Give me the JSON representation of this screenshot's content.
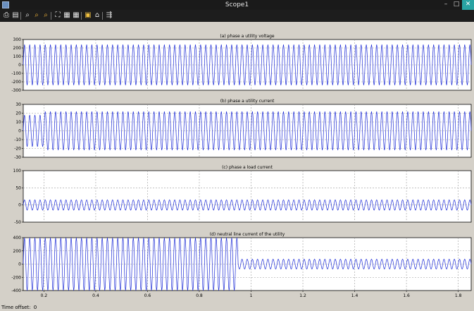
{
  "window": {
    "title": "Scope1",
    "minimize": "–",
    "maximize": "□",
    "close": "✕"
  },
  "toolbar": {
    "items": [
      {
        "name": "print-icon",
        "glyph": "⎙"
      },
      {
        "name": "parameters-icon",
        "glyph": "▤"
      },
      {
        "name": "zoom-in-icon",
        "glyph": "⌕"
      },
      {
        "name": "zoom-x-icon",
        "glyph": "⌕"
      },
      {
        "name": "zoom-y-icon",
        "glyph": "⌕"
      },
      {
        "name": "autoscale-icon",
        "glyph": "⛶"
      },
      {
        "name": "save-axes-icon",
        "glyph": "▦"
      },
      {
        "name": "restore-axes-icon",
        "glyph": "▦"
      },
      {
        "name": "floating-scope-icon",
        "glyph": "▣"
      },
      {
        "name": "lock-icon",
        "glyph": "⌂"
      },
      {
        "name": "signal-selection-icon",
        "glyph": "⇶"
      }
    ]
  },
  "status": {
    "time_offset_label": "Time offset:",
    "time_offset_value": "0"
  },
  "colors": {
    "trace": "#1c2bd6",
    "grid": "#9a9a9a",
    "axes_bg": "#ffffff",
    "frame": "#d4d0c8"
  },
  "x_axis": {
    "range": [
      0.12,
      1.85
    ],
    "ticks": [
      0.2,
      0.4,
      0.6,
      0.8,
      1,
      1.2,
      1.4,
      1.6,
      1.8
    ],
    "tick_labels": [
      "0.2",
      "0.4",
      "0.6",
      "0.8",
      "1",
      "1.2",
      "1.4",
      "1.6",
      "1.8"
    ]
  },
  "chart_data": [
    {
      "type": "line",
      "title": "(a) phase a utility voltage",
      "ylim": [
        -300,
        300
      ],
      "yticks": [
        -300,
        -200,
        -100,
        0,
        100,
        200,
        300
      ],
      "ytick_labels": [
        "-300",
        "-200",
        "-100",
        "0",
        "100",
        "200",
        "300"
      ],
      "frequency_hz": 50,
      "segments": [
        {
          "x_start": 0.12,
          "x_end": 1.85,
          "amplitude": 240
        }
      ]
    },
    {
      "type": "line",
      "title": "(b) phase a utility current",
      "ylim": [
        -30,
        30
      ],
      "yticks": [
        -30,
        -20,
        -10,
        0,
        10,
        20,
        30
      ],
      "ytick_labels": [
        "-30",
        "-20",
        "-10",
        "0",
        "10",
        "20",
        "30"
      ],
      "frequency_hz": 50,
      "segments": [
        {
          "x_start": 0.12,
          "x_end": 0.2,
          "amplitude": 18
        },
        {
          "x_start": 0.2,
          "x_end": 1.85,
          "amplitude": 22
        }
      ]
    },
    {
      "type": "line",
      "title": "(c) phase a load current",
      "ylim": [
        -50,
        100
      ],
      "yticks": [
        -50,
        0,
        50,
        100
      ],
      "ytick_labels": [
        "-50",
        "0",
        "50",
        "100"
      ],
      "frequency_hz": 50,
      "segments": [
        {
          "x_start": 0.12,
          "x_end": 1.85,
          "amplitude": 15
        }
      ]
    },
    {
      "type": "line",
      "title": "(d) neutral line current of the utility",
      "ylim": [
        -400,
        400
      ],
      "yticks": [
        -400,
        -200,
        0,
        200,
        400
      ],
      "ytick_labels": [
        "-400",
        "-200",
        "0",
        "200",
        "400"
      ],
      "frequency_hz": 50,
      "segments": [
        {
          "x_start": 0.12,
          "x_end": 0.95,
          "amplitude": 400
        },
        {
          "x_start": 0.95,
          "x_end": 1.85,
          "amplitude": 75
        }
      ]
    }
  ]
}
